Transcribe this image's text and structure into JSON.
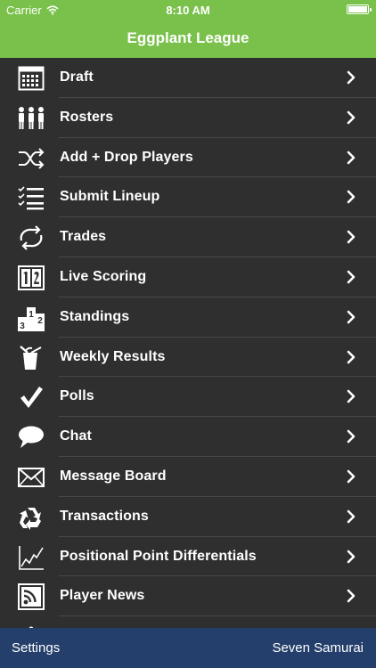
{
  "status": {
    "carrier": "Carrier",
    "time": "8:10 AM",
    "battery_level": 1.0
  },
  "header": {
    "title": "Eggplant League"
  },
  "menu": {
    "items": [
      {
        "label": "Draft",
        "icon": "calendar-grid-icon"
      },
      {
        "label": "Rosters",
        "icon": "people-icon"
      },
      {
        "label": "Add + Drop Players",
        "icon": "shuffle-icon"
      },
      {
        "label": "Submit Lineup",
        "icon": "checklist-icon"
      },
      {
        "label": "Trades",
        "icon": "swap-arrows-icon"
      },
      {
        "label": "Live Scoring",
        "icon": "scoreboard-icon"
      },
      {
        "label": "Standings",
        "icon": "podium-icon"
      },
      {
        "label": "Weekly Results",
        "icon": "bucket-icon"
      },
      {
        "label": "Polls",
        "icon": "checkmark-icon"
      },
      {
        "label": "Chat",
        "icon": "speech-bubble-icon"
      },
      {
        "label": "Message Board",
        "icon": "envelope-icon"
      },
      {
        "label": "Transactions",
        "icon": "recycle-icon"
      },
      {
        "label": "Positional Point Differentials",
        "icon": "line-chart-icon"
      },
      {
        "label": "Player News",
        "icon": "rss-feed-icon"
      },
      {
        "label": "",
        "icon": "more-icon"
      }
    ]
  },
  "footer": {
    "settings_label": "Settings",
    "team_name": "Seven Samurai"
  },
  "colors": {
    "header": "#79c14a",
    "menu_background": "#2f2f2f",
    "separator": "#474747",
    "footer": "#243f6b",
    "text": "#ffffff"
  }
}
